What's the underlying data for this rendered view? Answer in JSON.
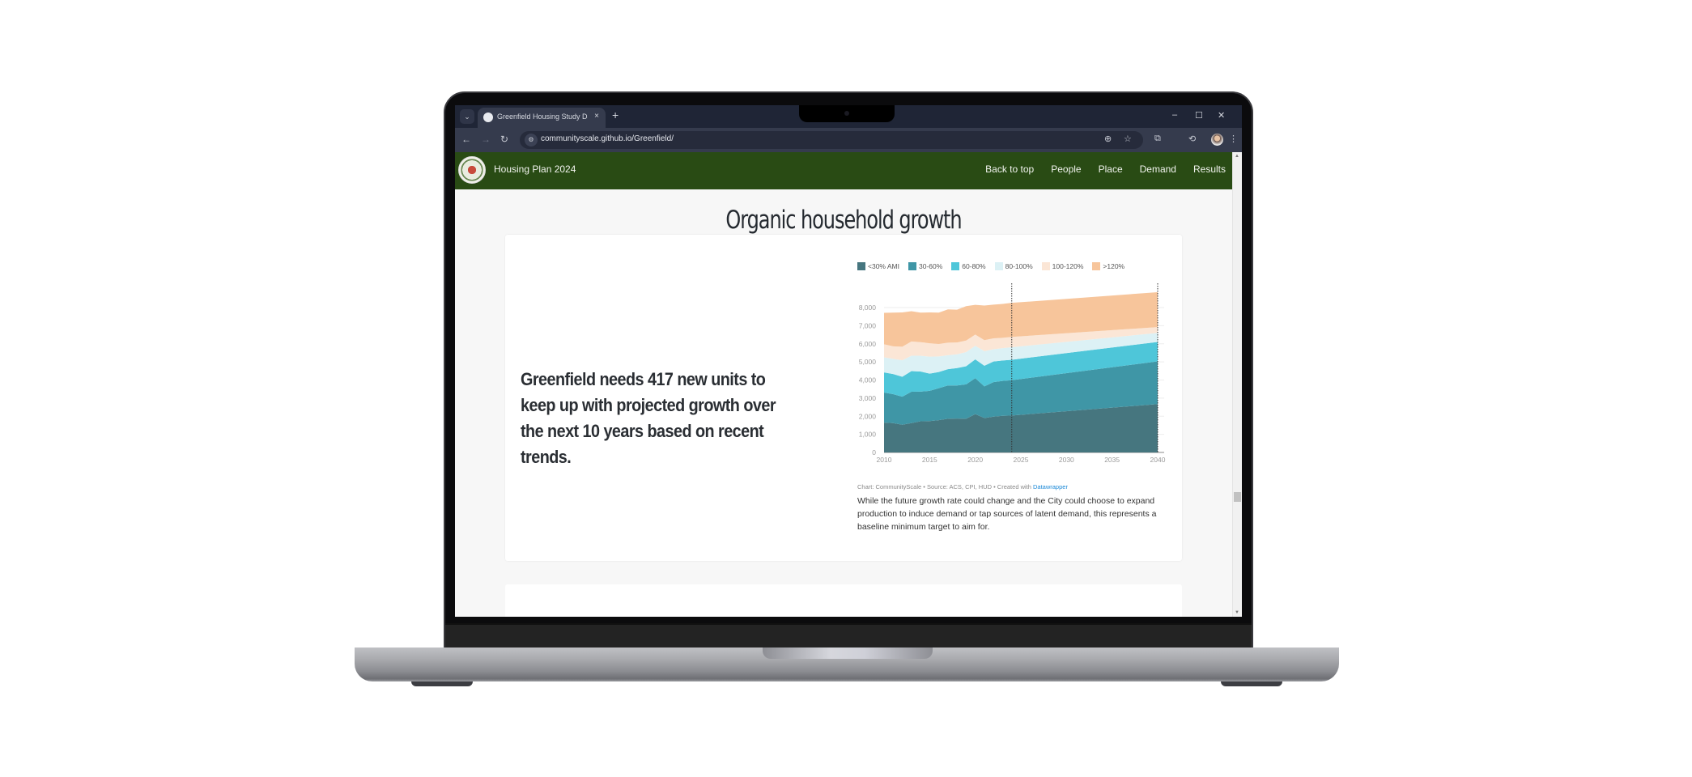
{
  "browser": {
    "tab_title": "Greenfield Housing Study Dashboard",
    "url": "communityscale.github.io/Greenfield/",
    "new_tab": "+",
    "tab_close": "×",
    "tab_menu": "⌄",
    "controls": {
      "minimize": "–",
      "maximize": "☐",
      "close": "✕"
    },
    "nav": {
      "back": "←",
      "forward": "→",
      "reload": "↻"
    },
    "icons": {
      "zoom": "⊕",
      "bookmark": "☆",
      "extensions": "⧉",
      "extension2": "⟲",
      "menu": "⋮",
      "site_settings": "⚙"
    }
  },
  "site": {
    "brand": "Housing Plan 2024",
    "nav_links": [
      "Back to top",
      "People",
      "Place",
      "Demand",
      "Results"
    ]
  },
  "section": {
    "title": "Organic household growth",
    "headline": "Greenfield needs 417 new units to keep up with projected growth over the next 10 years based on recent trends.",
    "source_prefix": "Chart: CommunityScale  • Source: ACS, CPI, HUD • Created with ",
    "source_link": "Datawrapper",
    "caption": "While the future growth rate could change and the City could choose to expand production to induce demand or tap sources of latent demand, this represents a baseline minimum target to aim for."
  },
  "chart_data": {
    "type": "area",
    "stacked": true,
    "title": "",
    "xlabel": "",
    "ylabel": "",
    "x": [
      2010,
      2011,
      2012,
      2013,
      2014,
      2015,
      2016,
      2017,
      2018,
      2019,
      2020,
      2021,
      2022,
      2023,
      2024,
      2040
    ],
    "x_ticks": [
      "2010",
      "2015",
      "2020",
      "2025",
      "2030",
      "2035",
      "2040"
    ],
    "y_ticks": [
      "0",
      "1,000",
      "2,000",
      "3,000",
      "4,000",
      "5,000",
      "6,000",
      "7,000",
      "8,000"
    ],
    "ylim": [
      0,
      8000
    ],
    "xlim": [
      2010,
      2040
    ],
    "grid": true,
    "legend_position": "top-left",
    "annotations": [
      {
        "type": "vertical-dotted-line",
        "x": 2024
      },
      {
        "type": "vertical-dotted-line",
        "x": 2040
      }
    ],
    "series": [
      {
        "name": "<30% AMI",
        "color": "#46767f",
        "values": [
          1650,
          1620,
          1530,
          1620,
          1720,
          1730,
          1780,
          1860,
          1870,
          1860,
          2120,
          1900,
          1980,
          2020,
          2040,
          2670
        ]
      },
      {
        "name": "30-60%",
        "color": "#3f96a6",
        "values": [
          1660,
          1600,
          1550,
          1730,
          1640,
          1670,
          1770,
          1840,
          1830,
          1900,
          1980,
          1750,
          1900,
          1930,
          1950,
          2360
        ]
      },
      {
        "name": "60-80%",
        "color": "#4ec6d9",
        "values": [
          1110,
          1110,
          1100,
          1140,
          1110,
          950,
          890,
          900,
          960,
          1000,
          1040,
          1140,
          1140,
          1130,
          1130,
          1070
        ]
      },
      {
        "name": "80-100%",
        "color": "#dcf1f5",
        "values": [
          830,
          840,
          910,
          850,
          870,
          940,
          860,
          770,
          760,
          780,
          750,
          800,
          680,
          680,
          690,
          500
        ]
      },
      {
        "name": "100-120%",
        "color": "#fbe6d6",
        "values": [
          720,
          690,
          750,
          790,
          750,
          740,
          690,
          690,
          650,
          640,
          620,
          610,
          600,
          570,
          570,
          320
        ]
      },
      {
        "name": ">120%",
        "color": "#f7c59b",
        "values": [
          1740,
          1860,
          1890,
          1670,
          1630,
          1700,
          1730,
          1840,
          1810,
          1900,
          1640,
          1910,
          1860,
          1870,
          1880,
          1930
        ]
      }
    ]
  }
}
